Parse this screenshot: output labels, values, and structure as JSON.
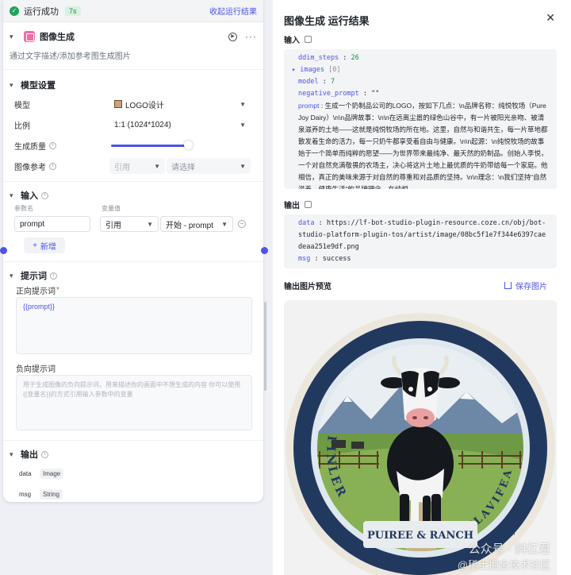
{
  "run_bar": {
    "status": "运行成功",
    "time": "7s",
    "collapse": "收起运行结果"
  },
  "node": {
    "title": "图像生成",
    "description": "通过文字描述/添加参考图生成图片"
  },
  "model_settings": {
    "title": "模型设置",
    "model_label": "模型",
    "model_value": "LOGO设计",
    "ratio_label": "比例",
    "ratio_value": "1:1 (1024*1024)",
    "quality_label": "生成质量",
    "quality_value": 0.58,
    "ref_label": "图像参考",
    "ref_mode": "引用",
    "ref_placeholder": "请选择"
  },
  "inputs": {
    "title": "输入",
    "col_name": "参数名",
    "col_value": "变量值",
    "rows": [
      {
        "name": "prompt",
        "type": "引用",
        "value": "开始 - prompt"
      }
    ],
    "add_label": "新增"
  },
  "prompts": {
    "title": "提示词",
    "positive_label": "正向提示词",
    "positive_value": "{{prompt}}",
    "negative_label": "负向提示词",
    "negative_placeholder": "用于生成图像的负向提示词，用来描述你的画面中不想生成的内容 你可以使用{{变量名}}的方式引用输入参数中的变量"
  },
  "outputs": {
    "title": "输出",
    "rows": [
      {
        "name": "data",
        "type": "Image"
      },
      {
        "name": "msg",
        "type": "String"
      }
    ]
  },
  "result": {
    "title": "图像生成 运行结果",
    "input_label": "输入",
    "ddim_steps_key": "ddim_steps",
    "ddim_steps": "26",
    "images_key": "images",
    "images_count": "[0]",
    "model_key": "model",
    "model": "7",
    "neg_key": "negative_prompt",
    "neg": "\"\"",
    "prompt_key": "prompt",
    "prompt": "生成一个奶制品公司的LOGO，按如下几点：\\n品牌名称：纯悦牧场（PureJoy Dairy）\\n\\n品牌故事：\\n\\n在远离尘嚣的绿色山谷中，有一片被阳光亲吻、被清泉滋养的土地——这就是纯悦牧场的所在地。这里，自然与和谐共生，每一片草地都散发着生命的活力，每一只奶牛都享受着自由与健康。\\n\\n起源：\\n纯悦牧场的故事始于一个简单而纯粹的愿望——为世界带来最纯净、最天然的奶制品。创始人李悦，一个对自然充满敬畏的农场主，决心将这片土地上最优质的牛奶带给每一个家庭。他相信，真正的美味来源于对自然的尊重和对品质的坚持。\\n\\n理念：\\n我们坚持“自然滋养，健康生活”的品牌理念。在纯悦",
    "output_label": "输出",
    "data_key": "data",
    "data": "https://lf-bot-studio-plugin-resource.coze.cn/obj/bot-studio-platform-plugin-tos/artist/image/08bc5f1e7f344e6397caedeaa251e9df.png",
    "msg_key": "msg",
    "msg": "success",
    "preview_label": "输出图片预览",
    "save_label": "保存图片"
  },
  "logo_image": {
    "text_left": "FINLER",
    "text_right": "FLAVIFEA",
    "text_bottom": "PUIREE & RANCH",
    "text_small": "Ehm"
  },
  "watermark": {
    "line1": "公众号 · 斜杠君",
    "line2": "@稀土掘金技术社区"
  },
  "colors": {
    "accent": "#4d53e8",
    "success": "#22a35a",
    "logo_navy": "#22395f"
  }
}
